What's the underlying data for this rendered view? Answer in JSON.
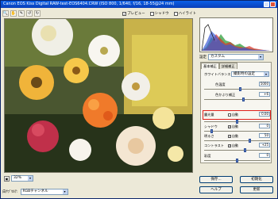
{
  "window": {
    "title": "Canon EOS Kiss Digital    RAW-test-EOS6404.CRW  (ISO 800, 1/640, f/16, 18-55@24 mm)"
  },
  "toolbar": {
    "tools": [
      {
        "icon": "zoom-icon",
        "glyph": "🔍"
      },
      {
        "icon": "hand-icon",
        "glyph": "✋"
      },
      {
        "icon": "eyedropper-icon",
        "glyph": "✎"
      },
      {
        "icon": "rotate-left-icon",
        "glyph": "↺"
      },
      {
        "icon": "rotate-right-icon",
        "glyph": "↻"
      }
    ],
    "preview_label": "プレビュー",
    "shadow_label": "シャドウ",
    "highlight_label": "ハイライト"
  },
  "bottombar": {
    "zoom_value": "32%"
  },
  "wb": {
    "label": "白ｻﾌﾞｾﾙﾃ:",
    "value": "RGBチャンネル"
  },
  "settings": {
    "label": "設定",
    "value": "カスタム"
  },
  "panel": {
    "tabs": [
      "基本補正",
      "詳細補正"
    ],
    "white_balance_label": "ホワイトバランス",
    "white_balance_value": "撮影時の設定",
    "rows": [
      {
        "label": "色温度",
        "value": "5000",
        "level": 0.55
      },
      {
        "label": "色かぶり補正",
        "value": "+6",
        "level": 0.6
      },
      {
        "label": "露光量",
        "auto_label": "自動",
        "value": "0.00",
        "level": 0.5
      },
      {
        "label": "シャドウ",
        "auto_label": "自動",
        "value": "0",
        "level": 0.1
      },
      {
        "label": "明るさ",
        "auto_label": "自動",
        "value": "50",
        "level": 0.7
      },
      {
        "label": "コントラスト",
        "auto_label": "自動",
        "value": "+25",
        "level": 0.62
      },
      {
        "label": "彩度",
        "value": "0",
        "level": 0.5
      }
    ]
  },
  "buttons": {
    "save": "保存...",
    "open": "初期化",
    "help": "ヘルプ",
    "update": "更新"
  }
}
